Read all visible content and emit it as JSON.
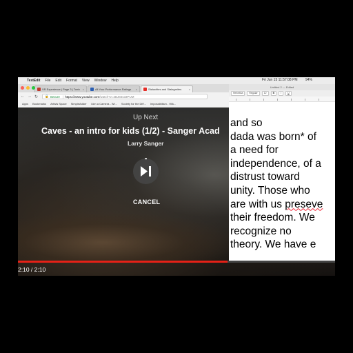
{
  "menubar": {
    "app": "TextEdit",
    "items": [
      "File",
      "Edit",
      "Format",
      "View",
      "Window",
      "Help"
    ],
    "datetime": "Fri Jun 15 11:57:08 PM",
    "battery": "94%"
  },
  "browser": {
    "tabs": [
      {
        "label": "VR Experience | Page 3 | Tonic",
        "color": "#c0392b"
      },
      {
        "label": "All Your Performance Ratings",
        "color": "#2c5fb3"
      },
      {
        "label": "Stalactites and Stalagmites",
        "color": "#e52d27",
        "active": true
      }
    ],
    "url_secure_label": "Secure",
    "url_host": "https://www.youtube.com",
    "url_path": "/watch?v=2BJ84s33PUM",
    "bookmarks": [
      "Apps",
      "Bookmarks",
      "Artists Space",
      "SimpleAdder",
      "I Am a Camera - Wi...",
      "Society for the Diff...",
      "Impossibilism - Wik..."
    ]
  },
  "video": {
    "up_next": "Up Next",
    "title": "Caves - an intro for kids (1/2) - Sanger Acad",
    "channel": "Larry Sanger",
    "cancel": "CANCEL",
    "time": "2:10 / 2:10",
    "progress": 0.66
  },
  "textedit": {
    "title": "Untitled 2 — Edited",
    "font": "Helvetica",
    "style": "Regular",
    "size": "12",
    "lines": [
      "and so",
      "dada was born* of",
      "a need for",
      "independence, of a",
      "distrust toward",
      "unity. Those who",
      "are with us preseve",
      "their freedom. We",
      "recognize no",
      "theory. We have e"
    ]
  },
  "colors": {
    "progress_red": "#e62117",
    "spell_squiggle": "#ee2233"
  }
}
